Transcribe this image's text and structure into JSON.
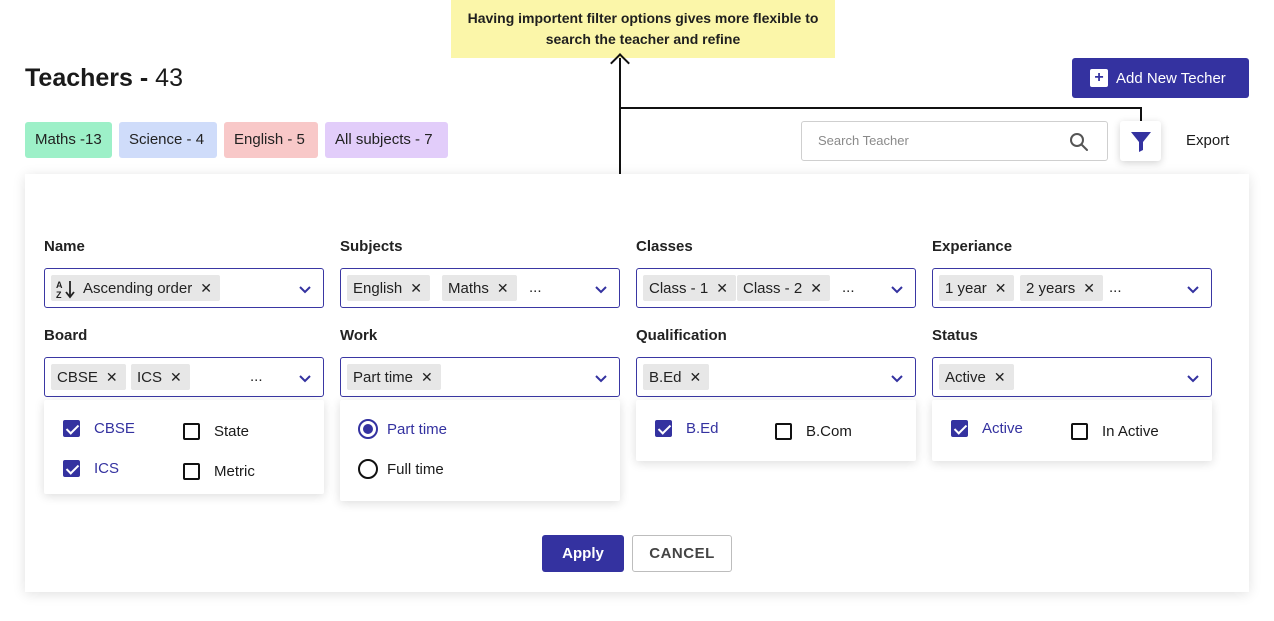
{
  "annotation": {
    "note_line1": "Having importent filter options gives more flexible to",
    "note_line2": "search the teacher and refine"
  },
  "header": {
    "title": "Teachers -",
    "count": "43",
    "add_button_label": "Add New Techer"
  },
  "subject_tabs": [
    {
      "label": "Maths -13",
      "color": "#9df0c8"
    },
    {
      "label": "Science - 4",
      "color": "#cfdcfa"
    },
    {
      "label": "English - 5",
      "color": "#f8c8c8"
    },
    {
      "label": "All subjects - 7",
      "color": "#e2cdfa"
    }
  ],
  "toolbar": {
    "search_placeholder": "Search Teacher",
    "export_label": "Export"
  },
  "filters": {
    "name": {
      "label": "Name",
      "chips": [
        "Ascending order"
      ]
    },
    "subjects": {
      "label": "Subjects",
      "chips": [
        "English",
        "Maths"
      ],
      "more": "..."
    },
    "classes": {
      "label": "Classes",
      "chips": [
        "Class - 1",
        "Class - 2"
      ],
      "more": "..."
    },
    "experience": {
      "label": "Experiance",
      "chips": [
        "1 year",
        "2 years"
      ],
      "more": "..."
    },
    "board": {
      "label": "Board",
      "chips": [
        "CBSE",
        "ICS"
      ],
      "more": "...",
      "options": [
        {
          "label": "CBSE",
          "checked": true
        },
        {
          "label": "State",
          "checked": false
        },
        {
          "label": "ICS",
          "checked": true
        },
        {
          "label": "Metric",
          "checked": false
        }
      ]
    },
    "work": {
      "label": "Work",
      "chips": [
        "Part time"
      ],
      "options": [
        {
          "label": "Part time",
          "selected": true
        },
        {
          "label": "Full time",
          "selected": false
        }
      ]
    },
    "qualification": {
      "label": "Qualification",
      "chips": [
        "B.Ed"
      ],
      "options": [
        {
          "label": "B.Ed",
          "checked": true
        },
        {
          "label": "B.Com",
          "checked": false
        }
      ]
    },
    "status": {
      "label": "Status",
      "chips": [
        "Active"
      ],
      "options": [
        {
          "label": "Active",
          "checked": true
        },
        {
          "label": "In Active",
          "checked": false
        }
      ]
    }
  },
  "actions": {
    "apply_label": "Apply",
    "cancel_label": "CANCEL"
  },
  "colors": {
    "accent": "#3432a0",
    "note_bg": "#fbf6a9"
  }
}
